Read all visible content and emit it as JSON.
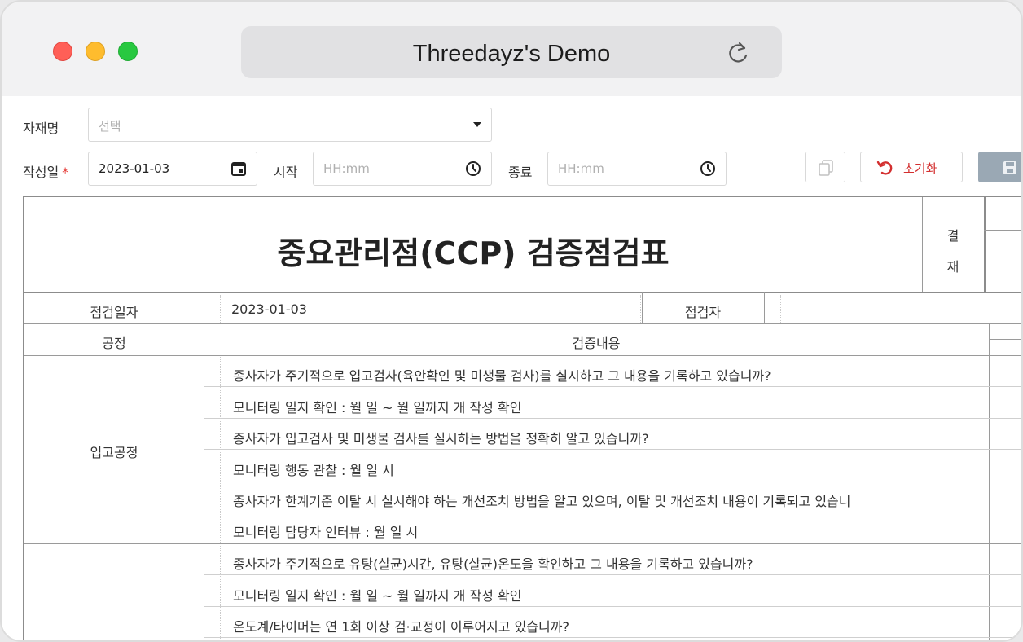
{
  "window": {
    "title": "Threedayz's Demo"
  },
  "filters": {
    "material_label": "자재명",
    "material_value": "선택",
    "date_label": "작성일",
    "date_required": "*",
    "date_value": "2023-01-03",
    "start_label": "시작",
    "start_placeholder": "HH:mm",
    "end_label": "종료",
    "end_placeholder": "HH:mm"
  },
  "toolbar": {
    "reset_label": "초기화"
  },
  "sheet": {
    "title": "중요관리점(CCP) 검증점검표",
    "approval_1": "결",
    "approval_2": "재",
    "inspect_date_label": "점검일자",
    "inspect_date_value": "2023-01-03",
    "inspector_label": "점검자",
    "inspector_value": "",
    "process_header": "공정",
    "content_header": "검증내용",
    "sections": [
      {
        "process": "입고공정",
        "rows": [
          "종사자가 주기적으로 입고검사(육안확인 및 미생물 검사)를 실시하고 그 내용을 기록하고 있습니까?",
          "모니터링 일지 확인 :   월   일 ~   월   일까지   개 작성 확인",
          "종사자가 입고검사 및 미생물 검사를 실시하는 방법을 정확히 알고 있습니까?",
          "모니터링 행동 관찰 :   월   일   시",
          "종사자가 한계기준 이탈 시 실시해야 하는 개선조치 방법을 알고 있으며, 이탈 및 개선조치 내용이 기록되고 있습니",
          "모니터링 담당자 인터뷰 :   월   일   시"
        ]
      },
      {
        "process": "",
        "rows": [
          "종사자가 주기적으로 유탕(살균)시간, 유탕(살균)온도을 확인하고 그 내용을 기록하고 있습니까?",
          "모니터링 일지 확인 :   월   일 ~   월   일까지   개 작성 확인",
          "온도계/타이머는 연 1회 이상 검·교정이 이루어지고 있습니까?"
        ]
      }
    ]
  }
}
